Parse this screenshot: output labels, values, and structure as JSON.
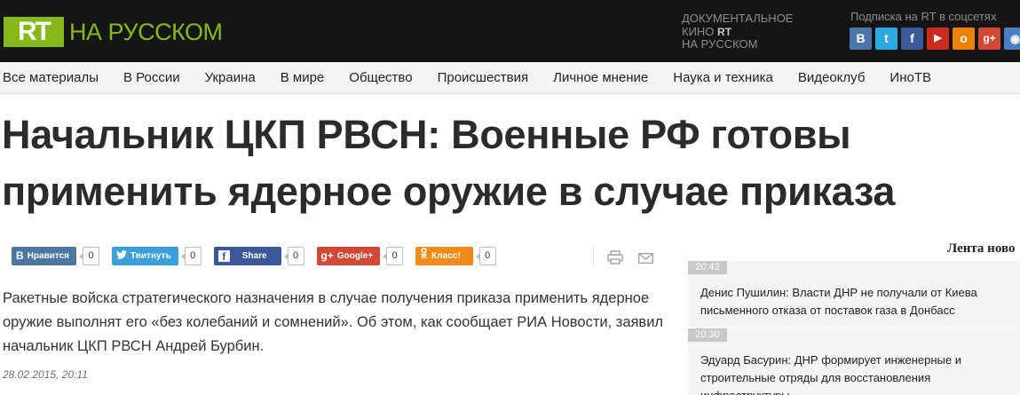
{
  "header": {
    "logo": "RT",
    "logo_sub": "НА РУССКОМ",
    "doc_line1": "ДОКУМЕНТАЛЬНОЕ",
    "doc_line2_prefix": "КИНО",
    "doc_line2_rt": "RT",
    "doc_line3": "НА РУССКОМ",
    "social_title": "Подписка на RT в соцсетях",
    "social": [
      {
        "name": "vk-icon",
        "glyph": "В",
        "color": "#4a76a8"
      },
      {
        "name": "twitter-icon",
        "glyph": "t",
        "color": "#2aa9e0"
      },
      {
        "name": "facebook-icon",
        "glyph": "f",
        "color": "#3b5998"
      },
      {
        "name": "youtube-icon",
        "glyph": "▶",
        "color": "#cc2b1f"
      },
      {
        "name": "odnoklassniki-icon",
        "glyph": "o",
        "color": "#ee8208"
      },
      {
        "name": "google-plus-icon",
        "glyph": "g+",
        "color": "#d34836"
      },
      {
        "name": "rss-icon",
        "glyph": "◉",
        "color": "#4a7ec0"
      }
    ]
  },
  "nav": [
    "Все материалы",
    "В России",
    "Украина",
    "В мире",
    "Общество",
    "Происшествия",
    "Личное мнение",
    "Наука и техника",
    "Видеоклуб",
    "ИноТВ"
  ],
  "article": {
    "title": "Начальник ЦКП РВСН: Военные РФ готовы применить ядерное оружие в случае приказа",
    "lead": "Ракетные войска стратегического назначения в случае получения приказа применить ядерное оружие выполнят его «без колебаний и сомнений». Об этом, как сообщает РИА Новости, заявил начальник ЦКП РВСН Андрей Бурбин.",
    "date": "28.02.2015, 20:11"
  },
  "shares": [
    {
      "icon": "vk-icon",
      "glyph": "В",
      "label": "Нравится",
      "count": "0",
      "color": "#4f75a3"
    },
    {
      "icon": "twitter-icon",
      "glyph": "🐦",
      "label": "Твитнуть",
      "count": "0",
      "color": "#3a9fdb"
    },
    {
      "icon": "facebook-icon",
      "glyph": "f",
      "label": "Share",
      "count": "0",
      "color": "#3b5998"
    },
    {
      "icon": "google-plus-icon",
      "glyph": "g+",
      "label": "Google+",
      "count": "0",
      "color": "#d14836"
    },
    {
      "icon": "odnoklassniki-icon",
      "glyph": "ok",
      "label": "Класс!",
      "count": "0",
      "color": "#f28a1c"
    }
  ],
  "feed": {
    "title": "Лента ново",
    "items": [
      {
        "time": "20:42",
        "text": "Денис Пушилин: Власти ДНР не получали от Киева письменного отказа от поставок газа в Донбасс"
      },
      {
        "time": "20:30",
        "text": "Эдуард Басурин: ДНР формирует инженерные и строительные отряды для восстановления инфраструктуры"
      }
    ]
  }
}
